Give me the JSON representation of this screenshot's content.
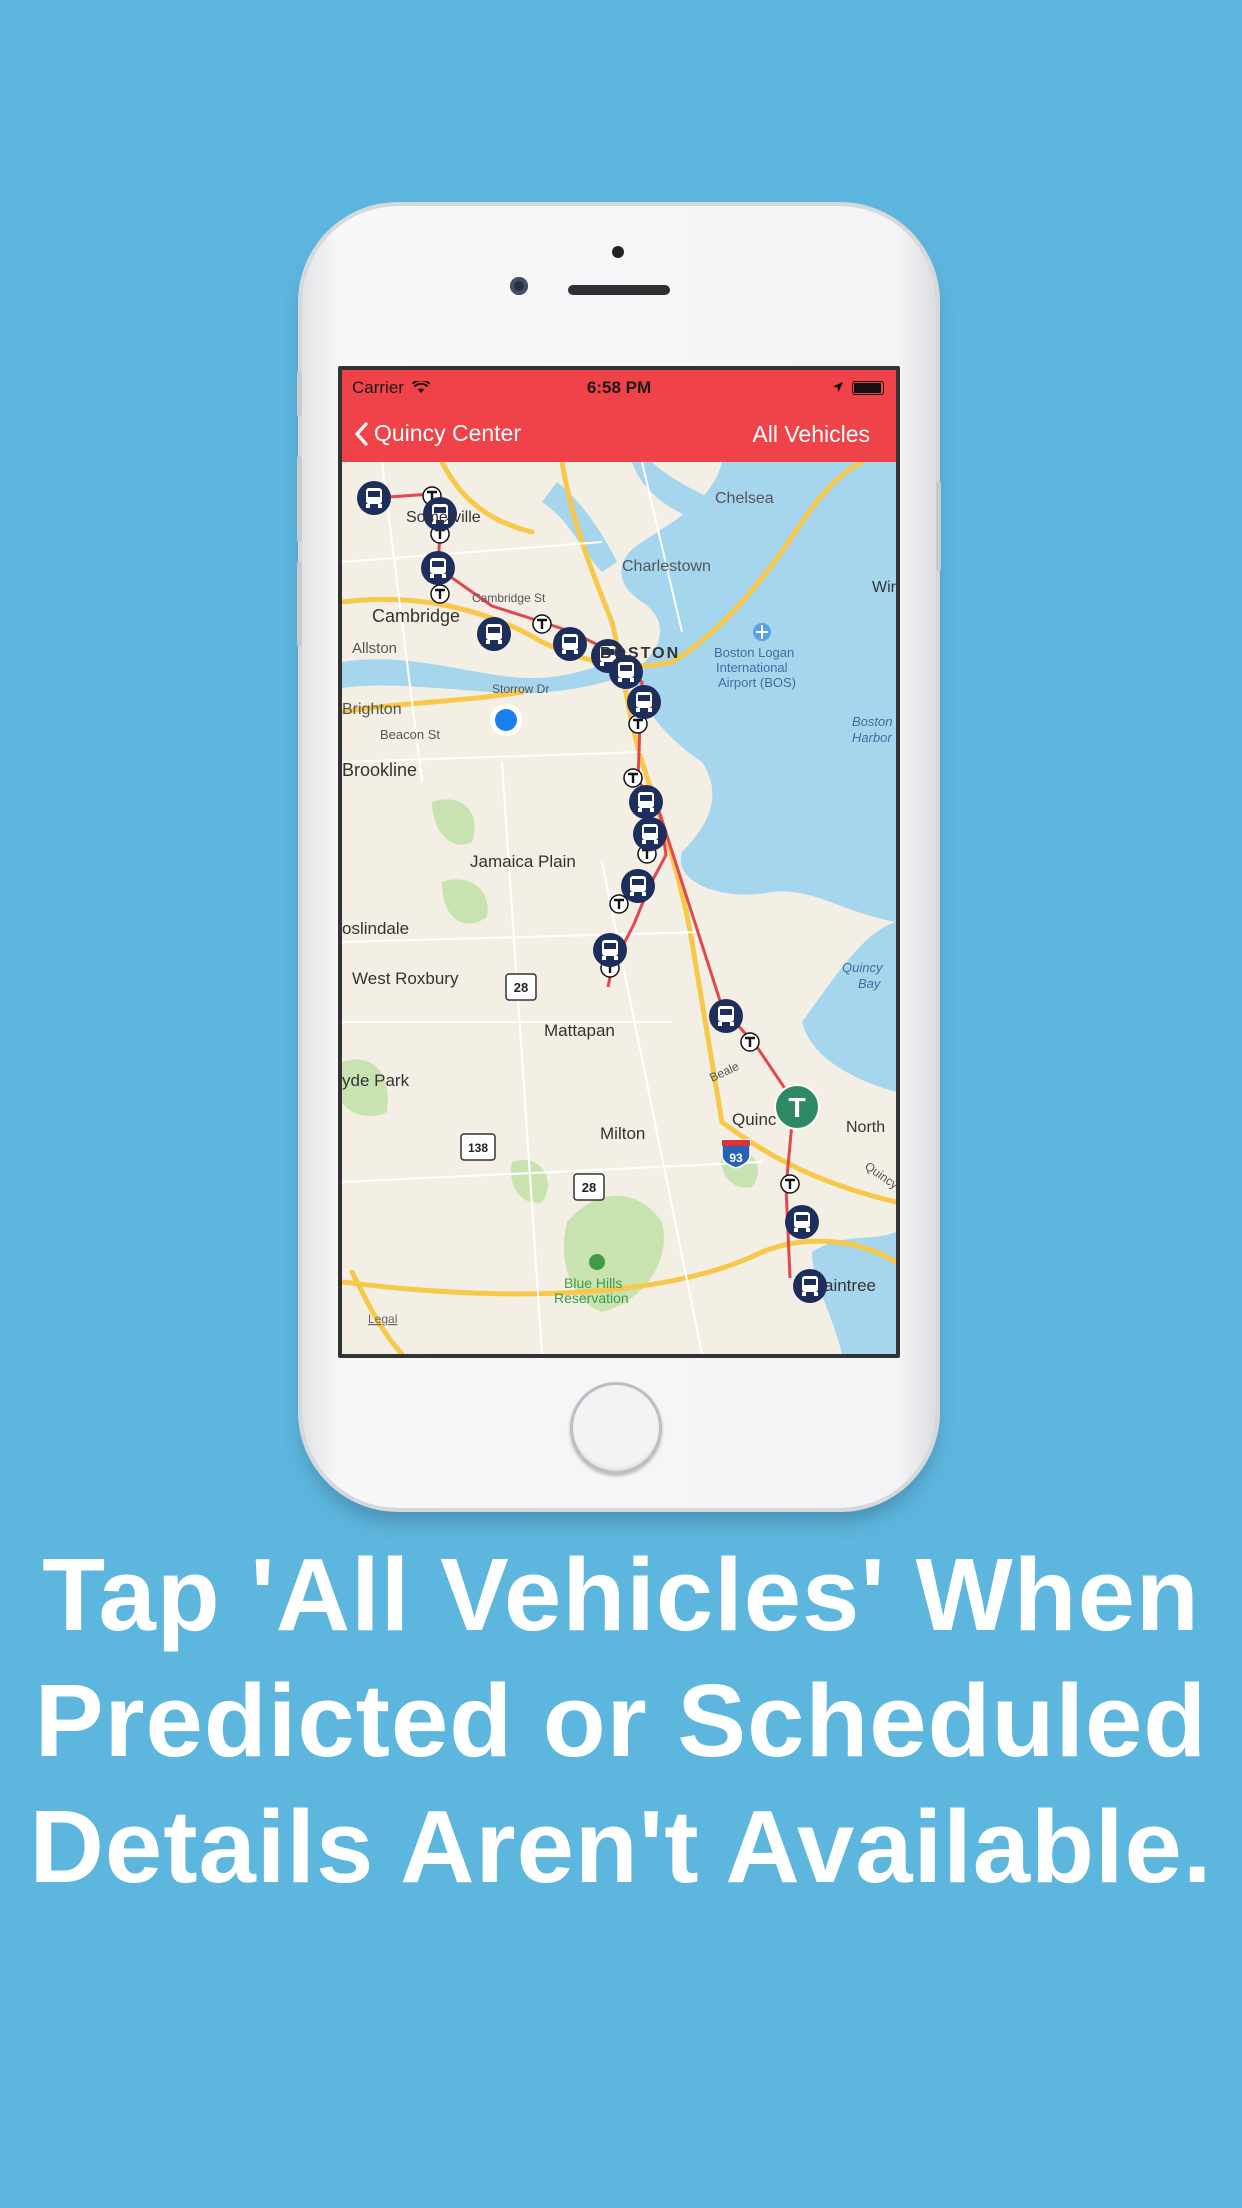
{
  "status_bar": {
    "carrier": "Carrier",
    "time": "6:58 PM"
  },
  "nav": {
    "back_label": "Quincy Center",
    "right_label": "All Vehicles"
  },
  "map_labels": {
    "chelsea": "Chelsea",
    "somerville": "Somerville",
    "charlestown": "Charlestown",
    "cambridge_st": "Cambridge St",
    "cambridge": "Cambridge",
    "allston": "Allston",
    "boston": "BOSTON",
    "airport_1": "Boston Logan",
    "airport_2": "International",
    "airport_3": "Airport (BOS)",
    "storrow": "Storrow Dr",
    "brighton": "Brighton",
    "beacon": "Beacon St",
    "harbor_1": "Boston",
    "harbor_2": "Harbor",
    "brookline": "Brookline",
    "jamaica": "Jamaica Plain",
    "roslindale": "oslindale",
    "quincy_bay_1": "Quincy",
    "quincy_bay_2": "Bay",
    "west_roxbury": "West Roxbury",
    "mattapan": "Mattapan",
    "hyde_park": "yde Park",
    "beale": "Beale",
    "quincy": "Quinc",
    "north": "North",
    "quincy_st": "Quincy",
    "milton": "Milton",
    "blue_hills_1": "Blue Hills",
    "blue_hills_2": "Reservation",
    "braintree": "aintree",
    "winthrop": "Wir",
    "legal": "Legal",
    "route_28a": "28",
    "route_28b": "28",
    "route_138": "138",
    "route_93": "93"
  },
  "map_colors": {
    "route_line": "#e2474f",
    "vehicle": "#1d2d5c",
    "station": "#2e8a64",
    "user_location": "#1a7ef0"
  },
  "station": {
    "glyph": "T"
  },
  "caption": {
    "line1": "Tap 'All Vehicles' When",
    "line2": "Predicted or Scheduled",
    "line3": "Details Aren't Available."
  }
}
